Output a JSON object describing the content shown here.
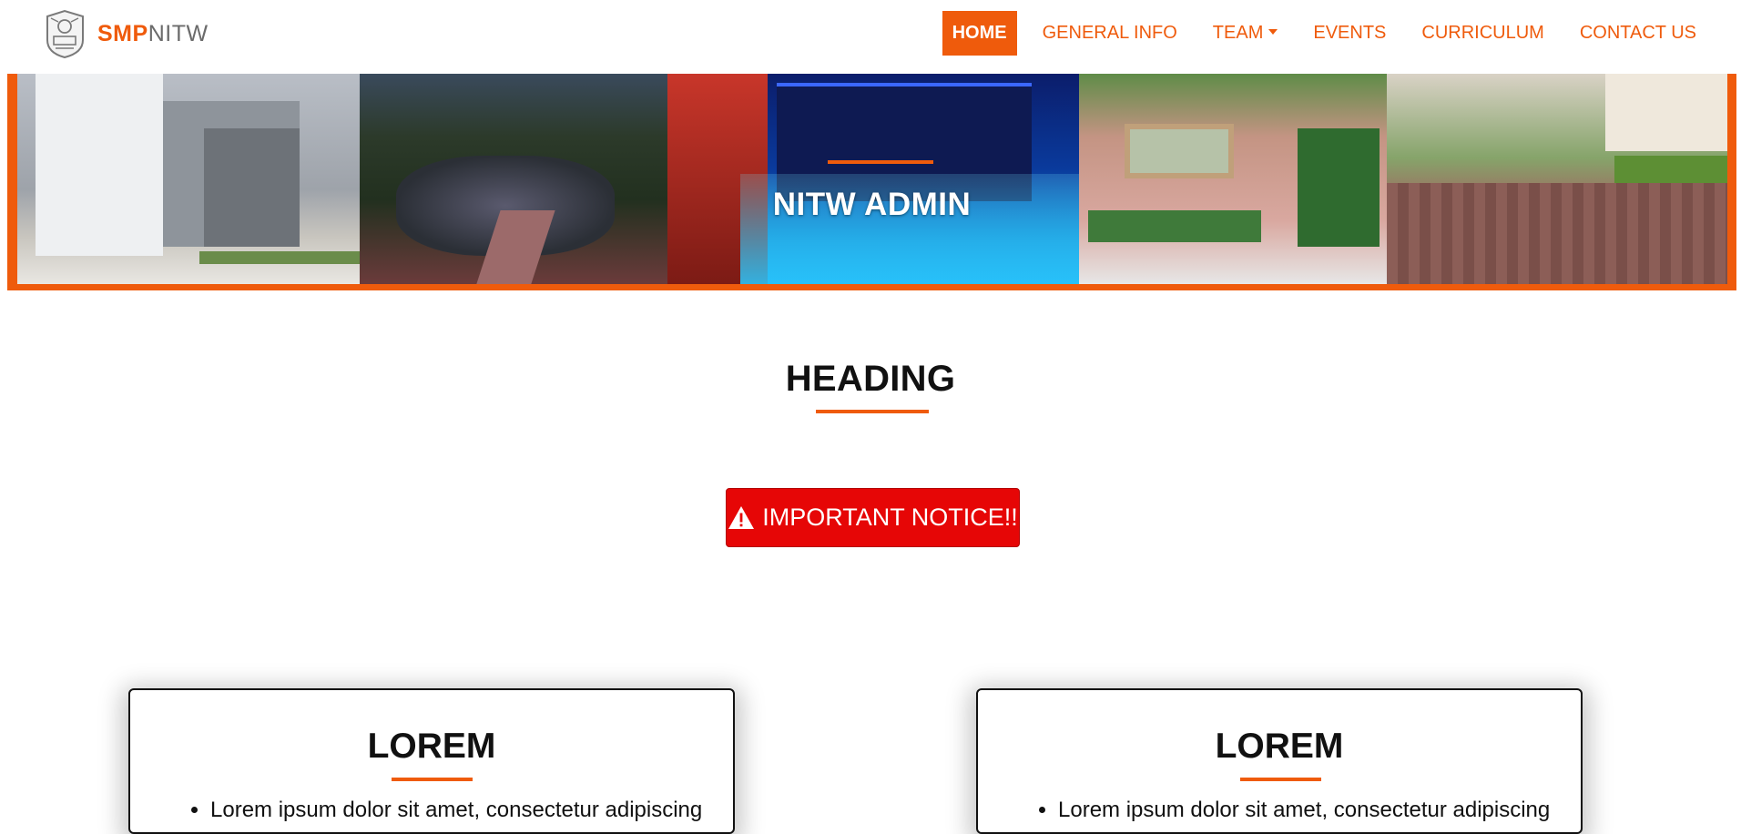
{
  "brand": {
    "strong": "SMP",
    "light": "NITW",
    "logo_icon": "nitw-emblem-icon"
  },
  "nav": {
    "items": [
      {
        "label": "HOME",
        "active": true
      },
      {
        "label": "GENERAL INFO",
        "active": false
      },
      {
        "label": "TEAM",
        "active": false,
        "dropdown": true
      },
      {
        "label": "EVENTS",
        "active": false
      },
      {
        "label": "CURRICULUM",
        "active": false
      },
      {
        "label": "CONTACT US",
        "active": false
      }
    ]
  },
  "banner": {
    "caption": "NITW ADMIN"
  },
  "section": {
    "heading": "HEADING"
  },
  "notice": {
    "label": "IMPORTANT NOTICE!!",
    "icon": "warning-icon"
  },
  "cards": [
    {
      "title": "LOREM",
      "items": [
        "Lorem ipsum dolor sit amet, consectetur adipiscing"
      ]
    },
    {
      "title": "LOREM",
      "items": [
        "Lorem ipsum dolor sit amet, consectetur adipiscing"
      ]
    }
  ],
  "colors": {
    "accent": "#ef5b0c",
    "notice_bg": "#e60606",
    "text": "#111111"
  }
}
